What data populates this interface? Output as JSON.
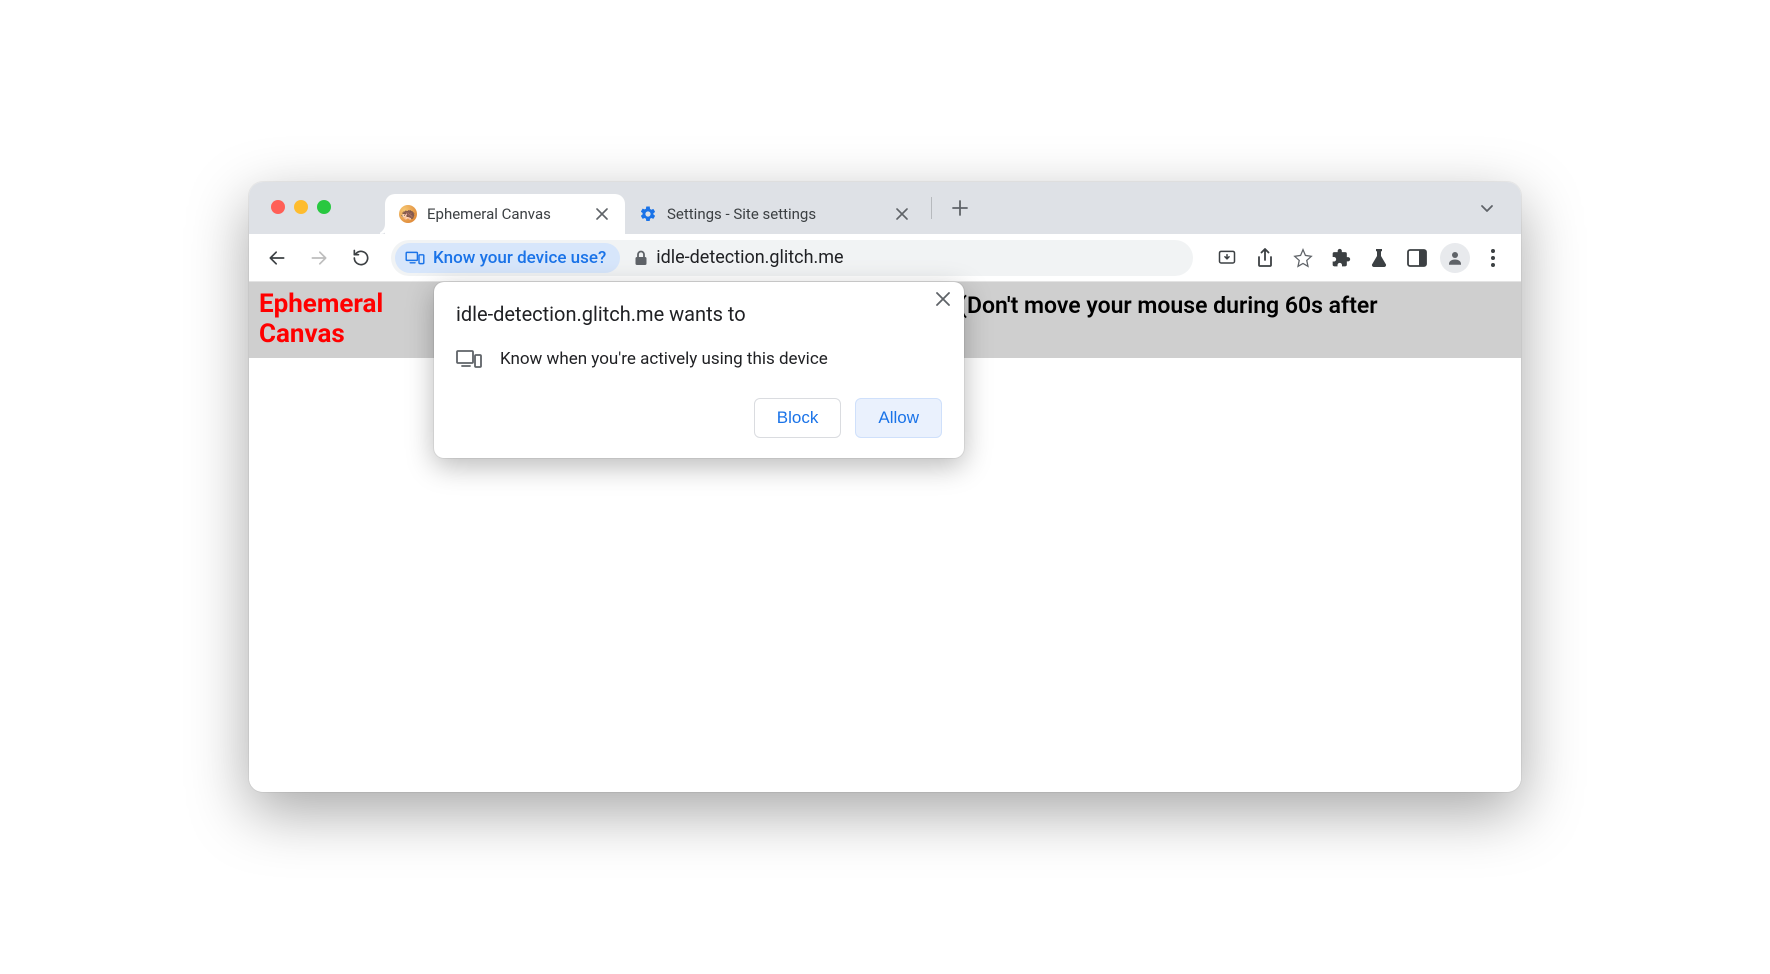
{
  "tabs": [
    {
      "title": "Ephemeral Canvas",
      "active": true
    },
    {
      "title": "Settings - Site settings",
      "active": false
    }
  ],
  "omnibox": {
    "chip_label": "Know your device use?",
    "url": "idle-detection.glitch.me"
  },
  "page": {
    "title": "Ephemeral Canvas",
    "instruction": "(Don't move your mouse during 60s after"
  },
  "permission": {
    "title": "idle-detection.glitch.me wants to",
    "item": "Know when you're actively using this device",
    "block": "Block",
    "allow": "Allow"
  }
}
